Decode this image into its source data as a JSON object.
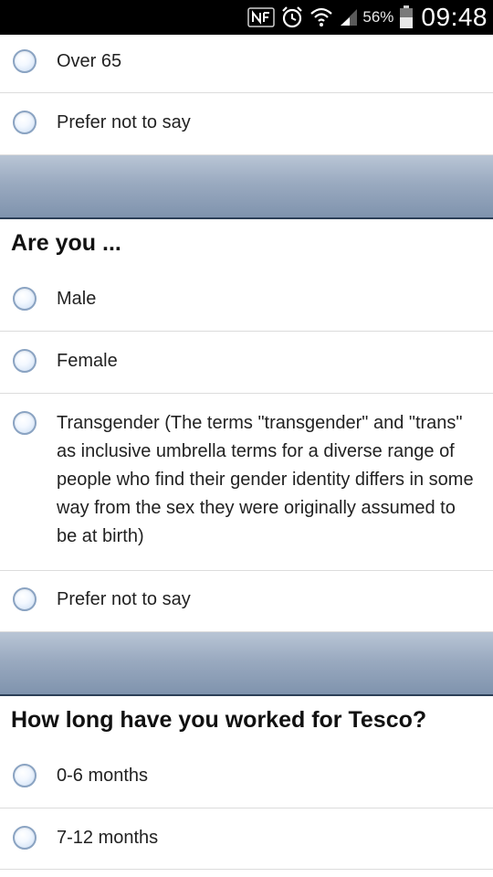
{
  "status_bar": {
    "icons": [
      "nfc-icon",
      "alarm-icon",
      "wifi-icon",
      "signal-icon",
      "battery-icon"
    ],
    "battery_percent": "56%",
    "time": "09:48"
  },
  "age_section": {
    "options": [
      {
        "label": "Over 65"
      },
      {
        "label": "Prefer not to say"
      }
    ]
  },
  "gender_section": {
    "question": "Are you ...",
    "options": [
      {
        "label": "Male"
      },
      {
        "label": "Female"
      },
      {
        "label": "Transgender (The terms \"transgender\" and \"trans\" as inclusive umbrella terms for a diverse range of people who find their gender identity differs in some way from the sex they were originally assumed to be at birth)"
      },
      {
        "label": "Prefer not to say"
      }
    ]
  },
  "tenure_section": {
    "question": "How long have you worked for Tesco?",
    "options": [
      {
        "label": "0-6 months"
      },
      {
        "label": "7-12 months"
      }
    ]
  },
  "colors": {
    "divider_top": "#b9c5d5",
    "divider_bottom": "#7f93ad",
    "radio_border": "#8aa3c2"
  }
}
